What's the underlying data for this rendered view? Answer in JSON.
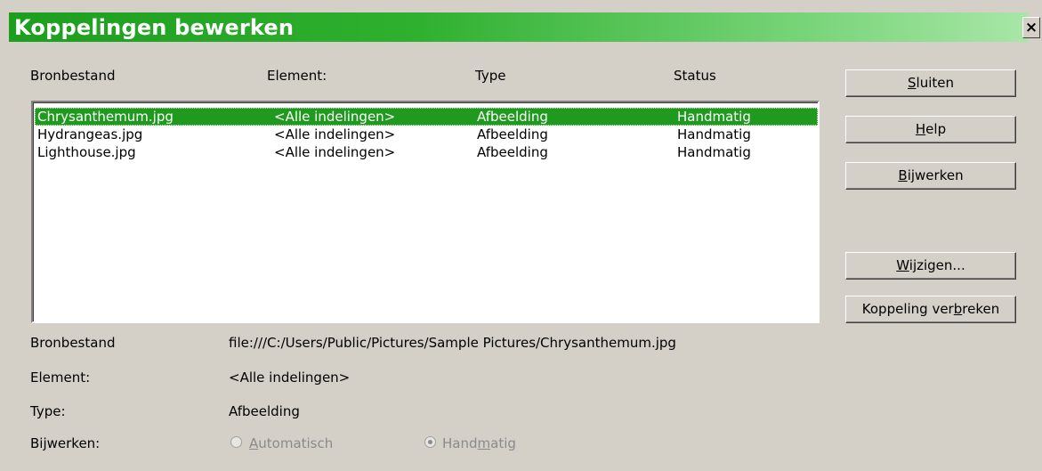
{
  "window": {
    "title": "Koppelingen bewerken",
    "close": "×"
  },
  "columns": [
    "Bronbestand",
    "Element:",
    "Type",
    "Status"
  ],
  "rows": [
    {
      "file": "Chrysanthemum.jpg",
      "element": "<Alle indelingen>",
      "type": "Afbeelding",
      "status": "Handmatig",
      "selected": true
    },
    {
      "file": "Hydrangeas.jpg",
      "element": "<Alle indelingen>",
      "type": "Afbeelding",
      "status": "Handmatig",
      "selected": false
    },
    {
      "file": "Lighthouse.jpg",
      "element": "<Alle indelingen>",
      "type": "Afbeelding",
      "status": "Handmatig",
      "selected": false
    }
  ],
  "buttons": {
    "close": {
      "pre": "",
      "key": "S",
      "post": "luiten"
    },
    "help": {
      "pre": "",
      "key": "H",
      "post": "elp"
    },
    "update": {
      "pre": "",
      "key": "B",
      "post": "ijwerken"
    },
    "change": {
      "pre": "",
      "key": "W",
      "post": "ijzigen..."
    },
    "break_link": {
      "pre": "Koppeling ver",
      "key": "b",
      "post": "reken"
    }
  },
  "details": {
    "source_label": "Bronbestand",
    "source_value": "file:///C:/Users/Public/Pictures/Sample Pictures/Chrysanthemum.jpg",
    "element_label": "Element:",
    "element_value": "<Alle indelingen>",
    "type_label": "Type:",
    "type_value": "Afbeelding",
    "update_label": "Bijwerken:"
  },
  "update_mode": {
    "automatic": {
      "pre": "",
      "key": "A",
      "post": "utomatisch",
      "checked": false
    },
    "manual": {
      "pre": "Hand",
      "key": "m",
      "post": "atig",
      "checked": true
    }
  }
}
